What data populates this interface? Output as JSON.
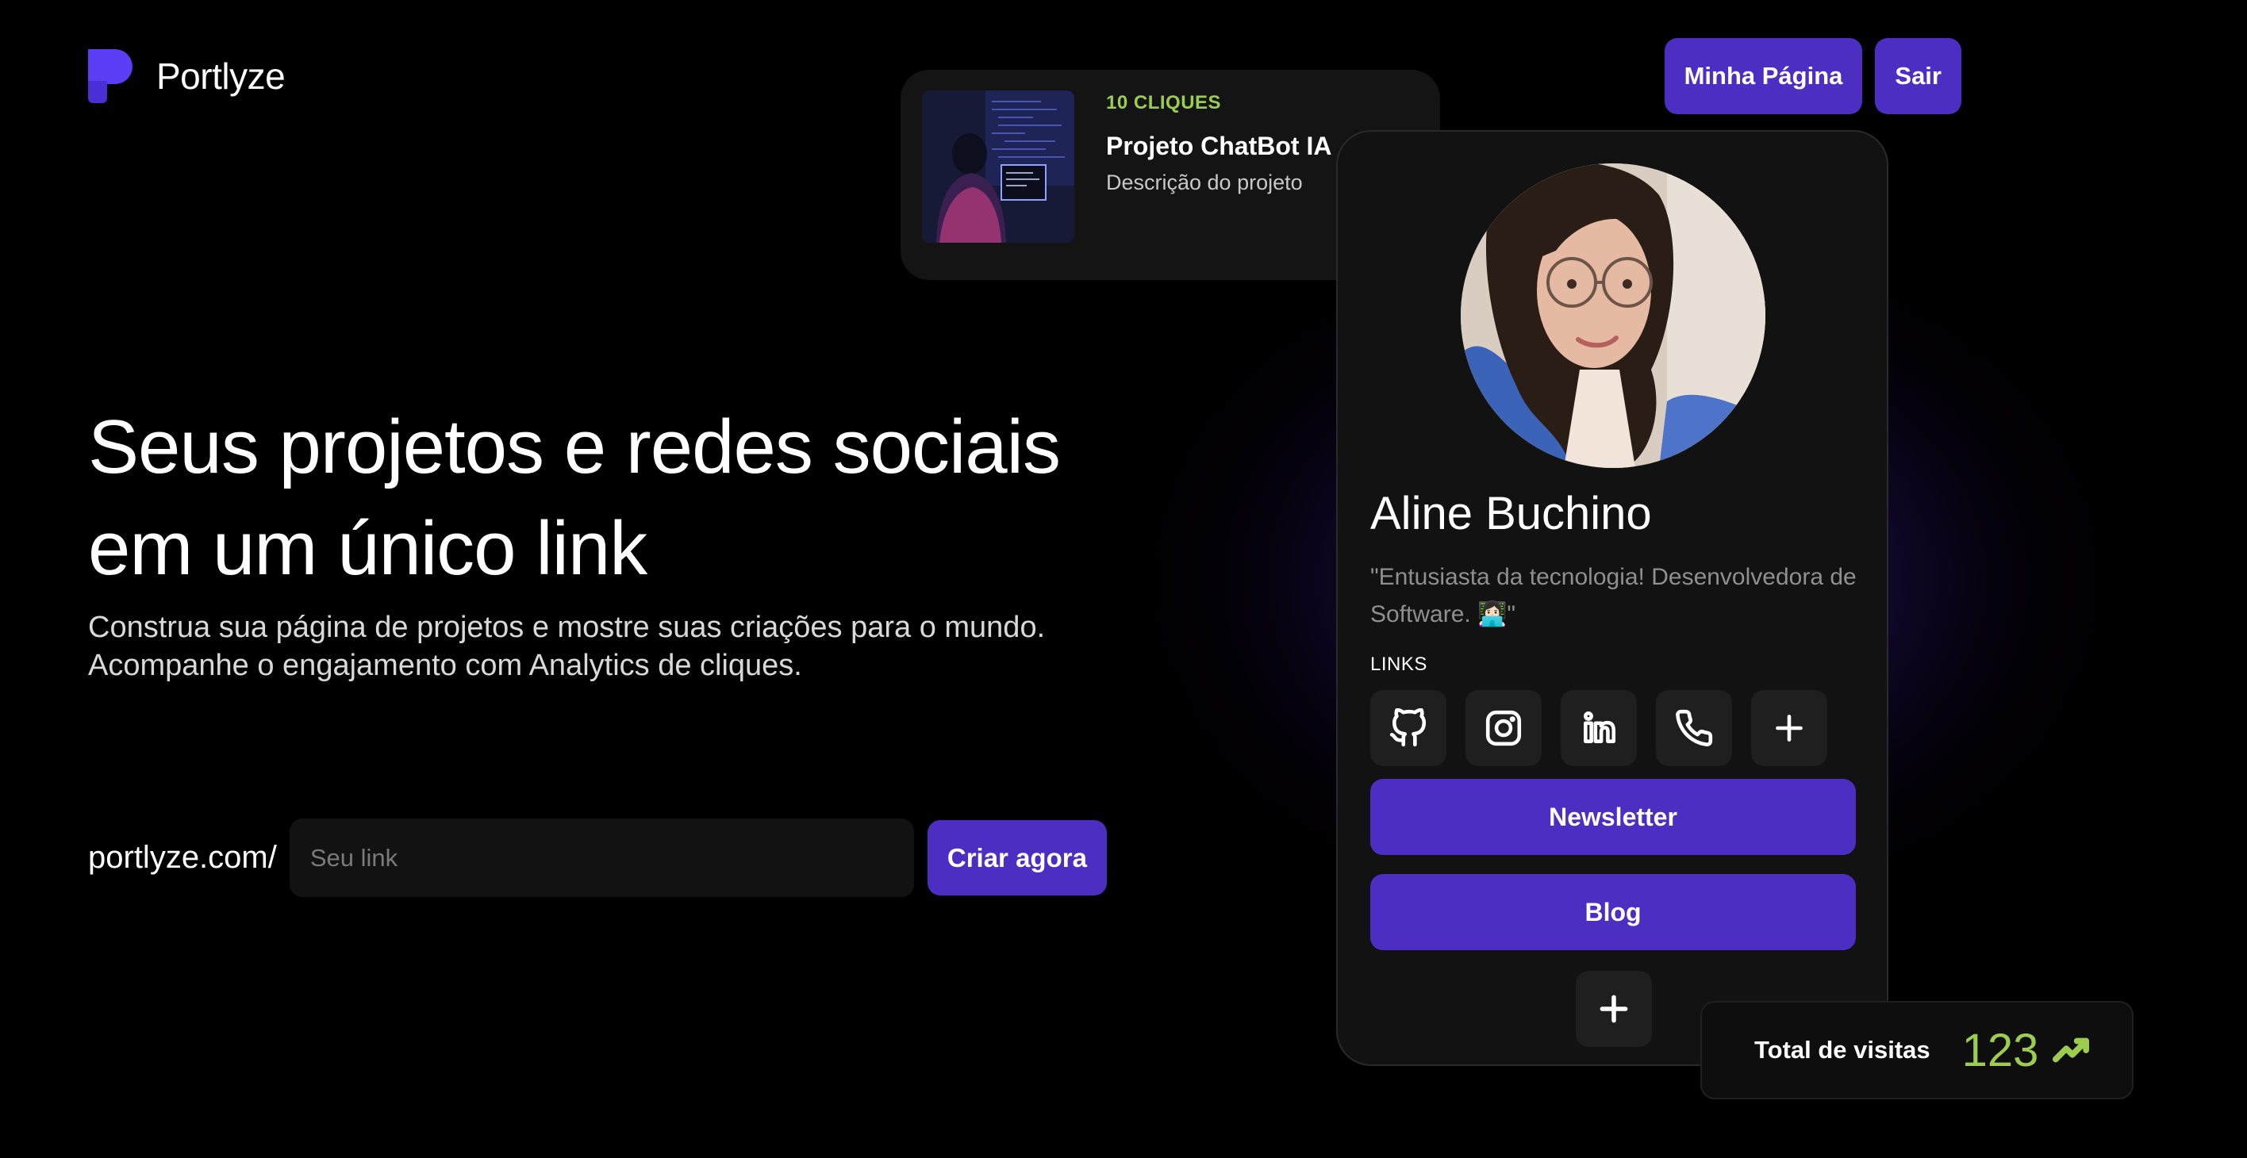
{
  "brand": {
    "name": "Portlyze"
  },
  "header": {
    "my_page_label": "Minha Página",
    "logout_label": "Sair"
  },
  "hero": {
    "title_line1": "Seus projetos e redes sociais",
    "title_line2": "em um único link",
    "subtitle_line1": "Construa sua página de projetos e mostre suas criações para o mundo.",
    "subtitle_line2": "Acompanhe o engajamento com Analytics de cliques."
  },
  "cta": {
    "prefix": "portlyze.com/",
    "placeholder": "Seu link",
    "button_label": "Criar agora"
  },
  "project_card": {
    "clicks": "10 CLIQUES",
    "title": "Projeto ChatBot IA",
    "description": "Descrição do projeto"
  },
  "profile": {
    "name": "Aline Buchino",
    "bio": "\"Entusiasta da tecnologia! Desenvolvedora de Software. 👩🏻‍💻\"",
    "links_label": "LINKS",
    "social_icons": [
      "github-icon",
      "instagram-icon",
      "linkedin-icon",
      "phone-icon",
      "plus-icon"
    ],
    "link_buttons": [
      {
        "label": "Newsletter"
      },
      {
        "label": "Blog"
      }
    ]
  },
  "visits": {
    "label": "Total de visitas",
    "count": "123",
    "trend_icon": "trending-up-icon"
  },
  "colors": {
    "accent": "#4c2fc2",
    "highlight": "#9ccd4f",
    "background": "#000000",
    "card": "#141414"
  }
}
